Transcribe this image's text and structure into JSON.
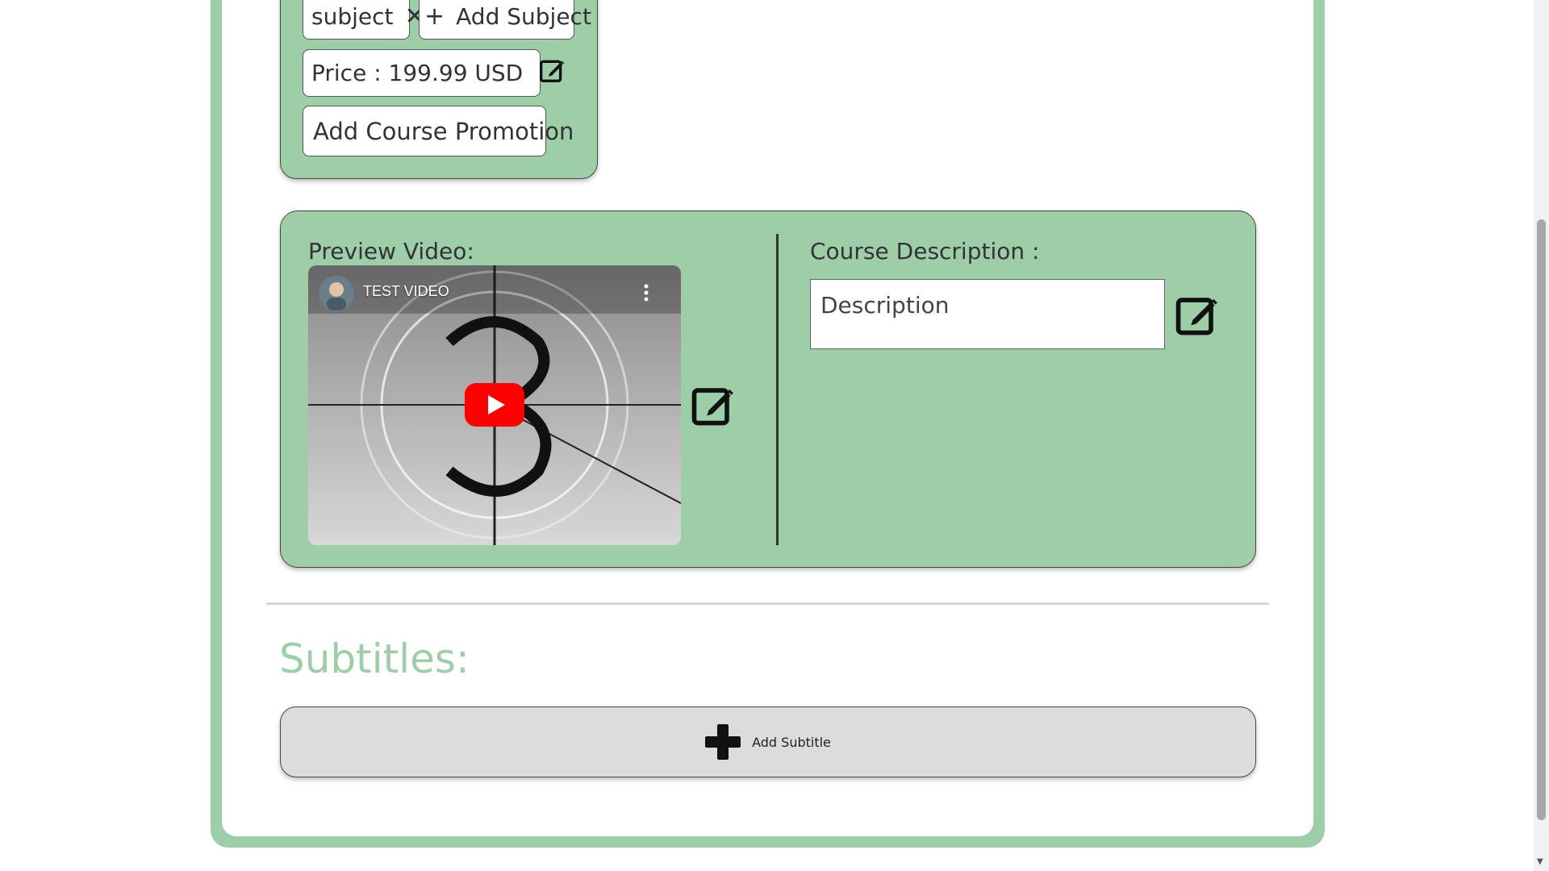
{
  "colors": {
    "accent_green": "#9dcea8",
    "panel_border": "#444444",
    "subtitle_bar": "#dcdcdc"
  },
  "course_meta": {
    "subject_chip": {
      "label": "subject",
      "remove_icon": "close-icon"
    },
    "add_subject": {
      "icon": "plus-icon",
      "label": "Add Subject"
    },
    "price": {
      "label": "Price : 199.99 USD",
      "edit_icon": "edit-icon"
    },
    "promotion_button": "Add Course Promotion"
  },
  "preview": {
    "label": "Preview Video:",
    "video_title": "TEST VIDEO",
    "play_icon": "youtube-play-icon",
    "more_icon": "kebab-menu-icon",
    "edit_icon": "edit-icon"
  },
  "description": {
    "label": "Course Description :",
    "placeholder": "Description",
    "edit_icon": "edit-icon"
  },
  "subtitles": {
    "heading": "Subtitles:",
    "add_button": {
      "icon": "plus-icon",
      "label": "Add Subtitle"
    }
  }
}
